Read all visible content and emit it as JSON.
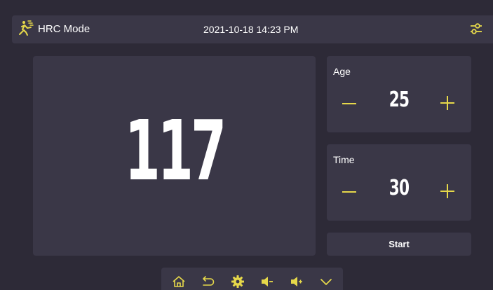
{
  "header": {
    "mode_icon": "running-person-icon",
    "title": "HRC Mode",
    "datetime": "2021-10-18 14:23 PM",
    "settings_icon": "sliders-icon"
  },
  "main": {
    "heart_rate_value": "117"
  },
  "age": {
    "label": "Age",
    "value": "25"
  },
  "time": {
    "label": "Time",
    "value": "30"
  },
  "start": {
    "label": "Start"
  },
  "bottom_nav": {
    "icons": [
      "home-icon",
      "back-icon",
      "gear-icon",
      "volume-down-icon",
      "volume-up-icon",
      "chevron-down-icon"
    ]
  },
  "colors": {
    "background": "#2d2a37",
    "panel": "#3a3747",
    "accent": "#e6d84a",
    "text": "#ffffff"
  }
}
